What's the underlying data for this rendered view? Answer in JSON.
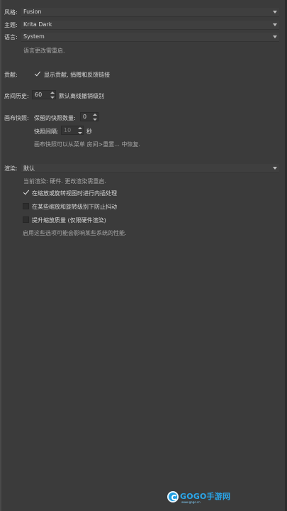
{
  "general": {
    "style_label": "风格:",
    "style_value": "Fusion",
    "theme_label": "主题:",
    "theme_value": "Krita Dark",
    "language_label": "语言:",
    "language_value": "System",
    "language_hint": "语言更改需重启."
  },
  "contribute": {
    "label": "贡献:",
    "checkbox_label": "显示贡献, 捐赠和反馈链接",
    "checked": true
  },
  "history": {
    "label": "房间历史:",
    "value": "60",
    "suffix": "默认离线撤销级别"
  },
  "snapshot": {
    "label": "画布快照:",
    "count_label": "保留的快照数量:",
    "count_value": "0",
    "interval_label": "快照间隔:",
    "interval_value": "10",
    "interval_unit": "秒",
    "hint": "画布快照可以从菜单 房间>重置... 中恢复."
  },
  "render": {
    "label": "渲染:",
    "value": "默认",
    "current": "当前渲染: 硬件. 更改渲染需重启.",
    "options": [
      {
        "label": "在缩放或旋转视图时进行内插处理",
        "checked": true
      },
      {
        "label": "在某些缩放和旋转级别下防止抖动",
        "checked": false
      },
      {
        "label": "提升缩放质量 (仅限硬件渲染)",
        "checked": false
      }
    ],
    "footer_hint": "启用这些选项可能会影响某些系统的性能."
  },
  "watermark": {
    "brand": "GOGO手游网",
    "sub": "www.gogo.cn"
  },
  "colors": {
    "background": "#3b3b3b",
    "text": "#d8d8d8",
    "hint": "#a8a8a8",
    "watermark": "#2aa6ea"
  }
}
